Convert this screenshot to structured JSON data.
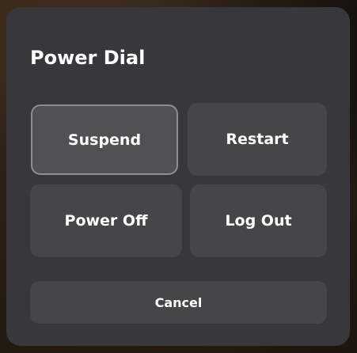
{
  "dialog": {
    "title": "Power Dial",
    "buttons": {
      "suspend": "Suspend",
      "restart": "Restart",
      "power_off": "Power Off",
      "log_out": "Log Out"
    },
    "cancel": "Cancel",
    "focused_button": "Suspend"
  },
  "colors": {
    "dialog_background": "#38383c",
    "button_background": "#464649",
    "focused_border": "#8e8e92",
    "text": "#ffffff"
  }
}
